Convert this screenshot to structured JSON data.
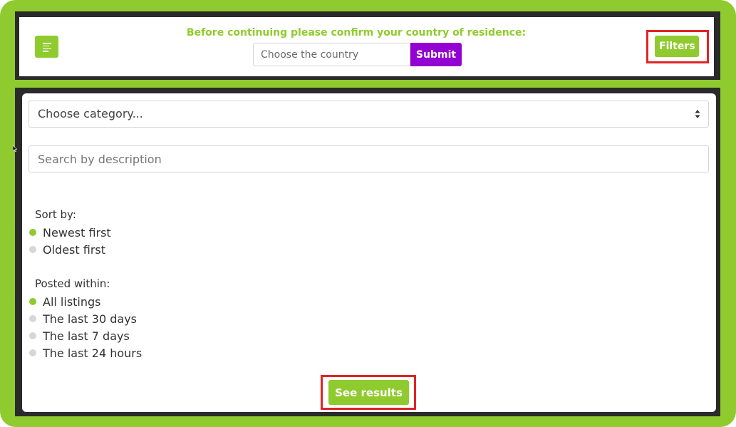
{
  "header": {
    "confirm_title": "Before continuing please confirm your country of residence:",
    "country_placeholder": "Choose the country",
    "submit_label": "Submit",
    "filters_label": "Filters",
    "menu_icon": "menu-icon"
  },
  "filters": {
    "category_placeholder": "Choose category...",
    "search_placeholder": "Search by description",
    "sort": {
      "label": "Sort by:",
      "options": [
        {
          "label": "Newest first",
          "selected": true
        },
        {
          "label": "Oldest first",
          "selected": false
        }
      ]
    },
    "posted": {
      "label": "Posted within:",
      "options": [
        {
          "label": "All listings",
          "selected": true
        },
        {
          "label": "The last 30 days",
          "selected": false
        },
        {
          "label": "The last 7 days",
          "selected": false
        },
        {
          "label": "The last 24 hours",
          "selected": false
        }
      ]
    },
    "results_label": "See results"
  },
  "colors": {
    "accent": "#8fcb2e",
    "submit": "#9400d3",
    "highlight": "#e02424",
    "frame_dark": "#2a2a2a"
  }
}
